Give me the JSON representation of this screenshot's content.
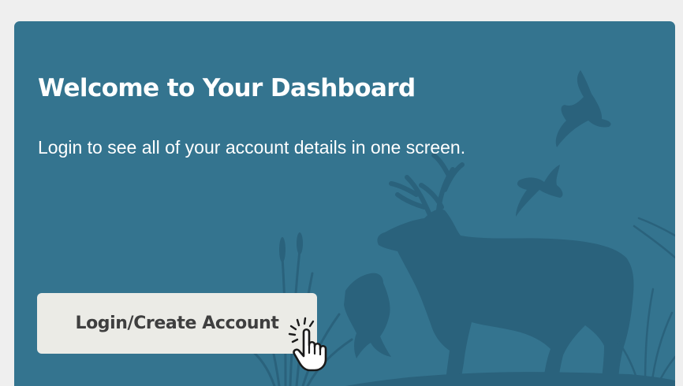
{
  "card": {
    "title": "Welcome to Your Dashboard",
    "subtitle": "Login to see all of your account details in one screen."
  },
  "login_button": {
    "label": "Login/Create Account"
  },
  "icons": {
    "background": "wildlife-silhouette-illustration",
    "cursor": "hand-pointer-click-icon"
  },
  "colors": {
    "page_background": "#efefef",
    "card_background": "#34748f",
    "silhouette": "#2a627c",
    "button_background": "#ebebe6",
    "button_text": "#3f3f3f",
    "text": "#ffffff"
  }
}
